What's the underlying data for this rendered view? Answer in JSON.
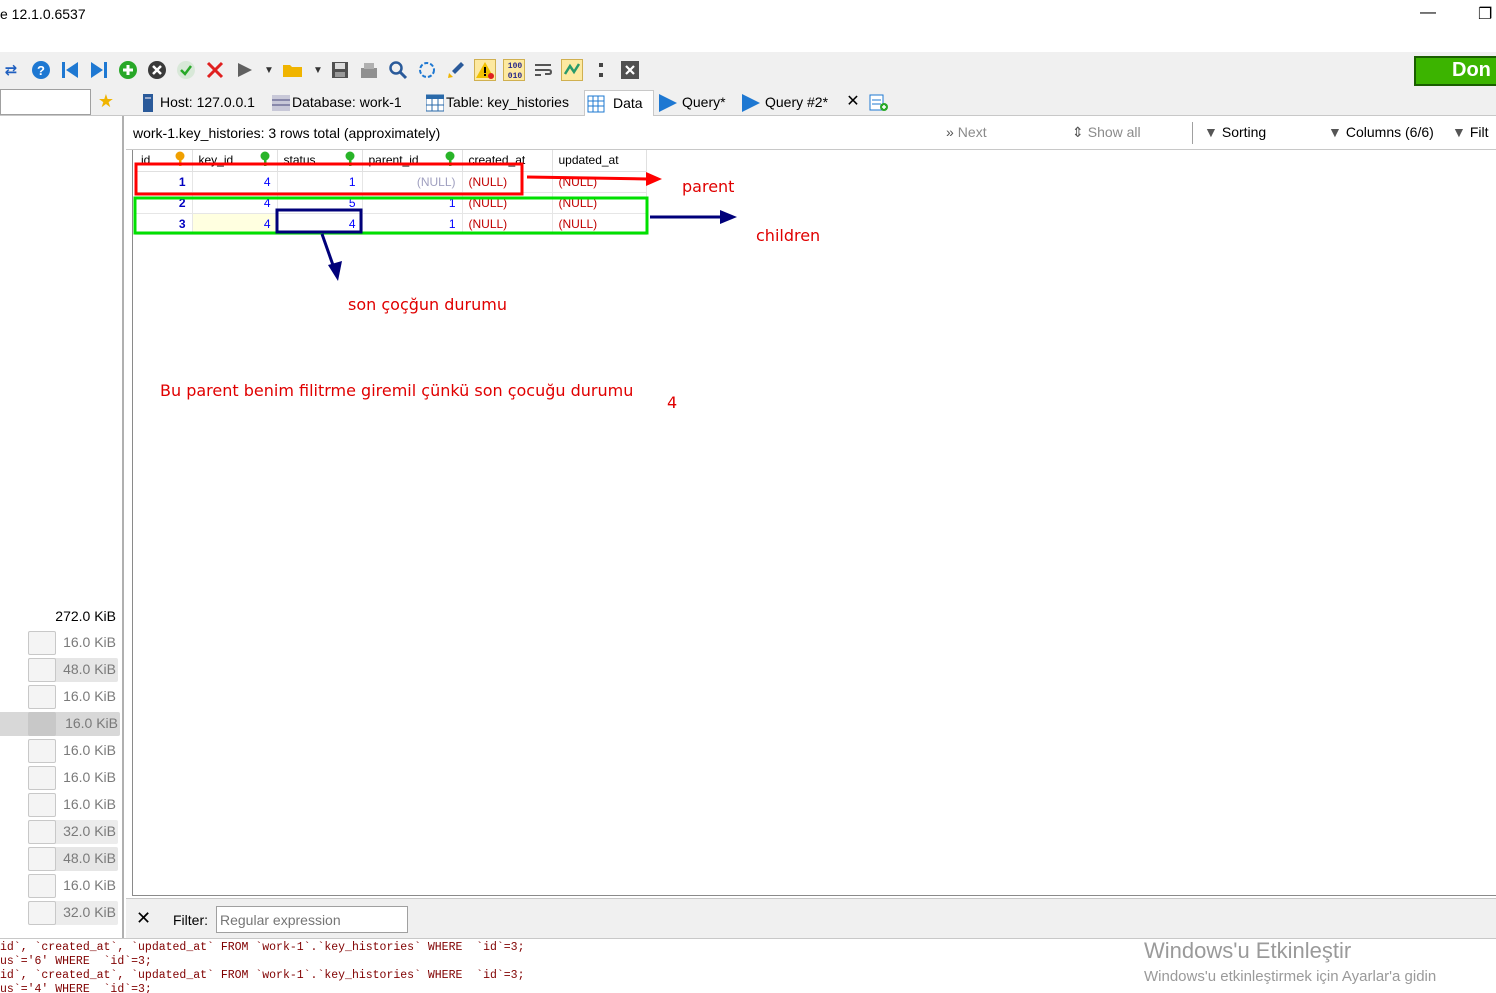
{
  "window": {
    "title": "e 12.1.0.6537",
    "minimize": "—",
    "restore": "❐"
  },
  "toolbar": {
    "done_label": "Don"
  },
  "tabs": [
    {
      "label": "Host: 127.0.0.1",
      "icon": "server-icon"
    },
    {
      "label": "Database: work-1",
      "icon": "database-icon"
    },
    {
      "label": "Table: key_histories",
      "icon": "table-icon"
    },
    {
      "label": "Data",
      "icon": "grid-icon"
    },
    {
      "label": "Query*",
      "icon": "play-icon"
    },
    {
      "label": "Query #2*",
      "icon": "play-icon"
    }
  ],
  "sizes": {
    "total": "272.0 KiB",
    "rows": [
      "16.0 KiB",
      "48.0 KiB",
      "16.0 KiB",
      "16.0 KiB",
      "16.0 KiB",
      "16.0 KiB",
      "16.0 KiB",
      "32.0 KiB",
      "48.0 KiB",
      "16.0 KiB",
      "32.0 KiB"
    ]
  },
  "infobar": {
    "summary": "work-1.key_histories: 3 rows total (approximately)",
    "next": "Next",
    "show_all": "Show all",
    "sorting": "Sorting",
    "columns": "Columns (6/6)",
    "filter": "Filt"
  },
  "grid": {
    "columns": [
      "id",
      "key_id",
      "status",
      "parent_id",
      "created_at",
      "updated_at"
    ],
    "rows": [
      [
        "1",
        "4",
        "1",
        "(NULL)",
        "(NULL)",
        "(NULL)"
      ],
      [
        "2",
        "4",
        "5",
        "1",
        "(NULL)",
        "(NULL)"
      ],
      [
        "3",
        "4",
        "4",
        "1",
        "(NULL)",
        "(NULL)"
      ]
    ]
  },
  "annotations": {
    "parent": "parent",
    "children": "children",
    "son_cocugun": "son çoçğun durumu",
    "sentence": "Bu parent benim filitrme giremil çünkü son çocuğu durumu",
    "four": "4"
  },
  "filterbar": {
    "label": "Filter:",
    "placeholder": "Regular expression"
  },
  "sqllog": [
    "id`, `created_at`, `updated_at` FROM `work-1`.`key_histories` WHERE  `id`=3;",
    "us`='6' WHERE  `id`=3;",
    "id`, `created_at`, `updated_at` FROM `work-1`.`key_histories` WHERE  `id`=3;",
    "us`='4' WHERE  `id`=3;"
  ],
  "watermark": {
    "line1": "Windows'u Etkinleştir",
    "line2": "Windows'u etkinleştirmek için Ayarlar'a gidin"
  },
  "colors": {
    "annotation_red": "#e00000",
    "annotation_green": "#00e000",
    "annotation_navy": "#00007a",
    "done_green": "#3cb400"
  }
}
